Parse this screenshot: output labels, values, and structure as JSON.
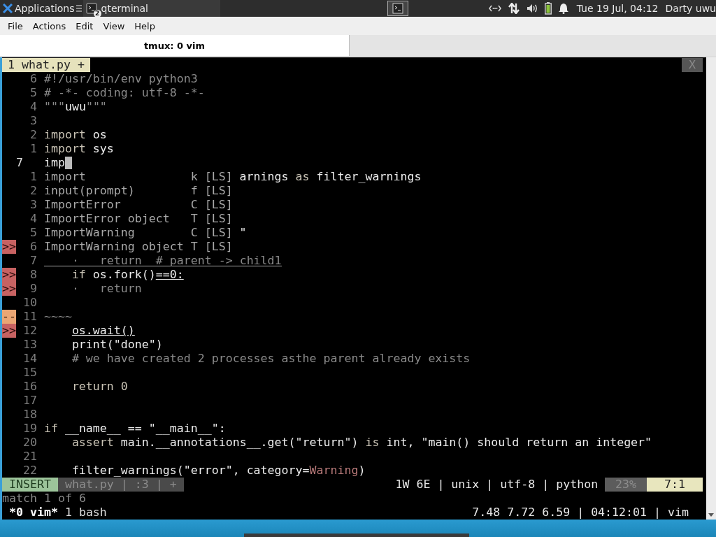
{
  "panel": {
    "apps_label": "Applications",
    "task": {
      "label": "qterminal",
      "badge": "2"
    },
    "clock": "Tue 19 Jul, 04:12",
    "user": "Darty uwu"
  },
  "menu": [
    "File",
    "Actions",
    "Edit",
    "View",
    "Help"
  ],
  "tabs": [
    {
      "label": "tmux: 0 vim",
      "selected": true
    }
  ],
  "vim": {
    "buffer_tab": {
      "label": "1 what.py +",
      "selected": true
    },
    "close_label": "X",
    "rows": [
      {
        "number": "6",
        "segments": [
          {
            "text": "#!/usr/bin/env python3",
            "kind": "comment"
          }
        ]
      },
      {
        "number": "5",
        "segments": [
          {
            "text": "# -*- coding: utf-8 -*-",
            "kind": "comment"
          }
        ]
      },
      {
        "number": "4",
        "segments": [
          {
            "text": "\"\"\"",
            "kind": "comment"
          },
          {
            "text": "uwu",
            "kind": "plain"
          },
          {
            "text": "\"\"\"",
            "kind": "comment"
          }
        ]
      },
      {
        "number": "3"
      },
      {
        "number": "2",
        "segments": [
          {
            "text": "import",
            "kind": "keyword"
          },
          {
            "text": " os",
            "kind": "plain"
          }
        ]
      },
      {
        "number": "1",
        "segments": [
          {
            "text": "import",
            "kind": "keyword"
          },
          {
            "text": " sys",
            "kind": "plain"
          }
        ]
      },
      {
        "number": "7",
        "current": true,
        "cursor": true,
        "segments": [
          {
            "text": "imp",
            "kind": "plain"
          }
        ]
      },
      {
        "number": "1",
        "completion": {
          "word": "import",
          "letter": "k",
          "source": "[LS]"
        },
        "segments": [
          {
            "text": "arnings",
            "kind": "plain"
          },
          {
            "text": " as ",
            "kind": "keyword"
          },
          {
            "text": "filter_warnings",
            "kind": "plain"
          }
        ]
      },
      {
        "number": "2",
        "completion": {
          "word": "input(prompt)",
          "letter": "f",
          "source": "[LS]"
        }
      },
      {
        "number": "3",
        "completion": {
          "word": "ImportError",
          "letter": "C",
          "source": "[LS]"
        }
      },
      {
        "number": "4",
        "completion": {
          "word": "ImportError object",
          "letter": "T",
          "source": "[LS]"
        }
      },
      {
        "number": "5",
        "completion": {
          "word": "ImportWarning",
          "letter": "C",
          "source": "[LS]"
        },
        "segments": [
          {
            "text": "\"",
            "kind": "plain"
          }
        ]
      },
      {
        "number": "6",
        "sign": {
          "text": ">>",
          "kind": "error"
        },
        "completion": {
          "word": "ImportWarning object",
          "letter": "T",
          "source": "[LS]"
        }
      },
      {
        "number": "7",
        "underlined": true,
        "indented": true,
        "segments": [
          {
            "text": "·   return  # parent -> child1",
            "kind": "comment"
          }
        ]
      },
      {
        "number": "8",
        "sign": {
          "text": ">>",
          "kind": "error"
        },
        "indented": true,
        "segments": [
          {
            "text": "if",
            "kind": "keyword"
          },
          {
            "text": " os.fork()",
            "kind": "plain"
          },
          {
            "text": "==0:",
            "kind": "underline"
          }
        ]
      },
      {
        "number": "9",
        "sign": {
          "text": ">>",
          "kind": "error"
        },
        "indented": true,
        "segments": [
          {
            "text": "·   return",
            "kind": "comment"
          }
        ]
      },
      {
        "number": "10"
      },
      {
        "number": "11",
        "sign": {
          "text": "--",
          "kind": "warning"
        },
        "segments": [
          {
            "text": "~~~~",
            "kind": "comment"
          }
        ]
      },
      {
        "number": "12",
        "sign": {
          "text": ">>",
          "kind": "error"
        },
        "indented": true,
        "segments": [
          {
            "text": "os.wait()",
            "kind": "underline"
          }
        ]
      },
      {
        "number": "13",
        "indented": true,
        "segments": [
          {
            "text": "print(\"done\")",
            "kind": "plain"
          }
        ]
      },
      {
        "number": "14",
        "indented": true,
        "segments": [
          {
            "text": "# we have created 2 processes asthe parent already exists",
            "kind": "comment"
          }
        ]
      },
      {
        "number": "15"
      },
      {
        "number": "16",
        "indented": true,
        "segments": [
          {
            "text": "return 0",
            "kind": "keyword"
          }
        ]
      },
      {
        "number": "17"
      },
      {
        "number": "18"
      },
      {
        "number": "19",
        "segments": [
          {
            "text": "if",
            "kind": "keyword"
          },
          {
            "text": " __name__ == \"__main__\":",
            "kind": "plain"
          }
        ]
      },
      {
        "number": "20",
        "indented": true,
        "segments": [
          {
            "text": "assert",
            "kind": "keyword"
          },
          {
            "text": " main.__annotations__.get(\"return\") ",
            "kind": "plain"
          },
          {
            "text": "is",
            "kind": "keyword"
          },
          {
            "text": " int, \"main() should return an integer\"",
            "kind": "plain"
          }
        ]
      },
      {
        "number": "21"
      },
      {
        "number": "22",
        "indented": true,
        "segments": [
          {
            "text": "filter_warnings(\"error\", category=",
            "kind": "plain"
          },
          {
            "text": "Warning",
            "kind": "type"
          },
          {
            "text": ")",
            "kind": "plain"
          }
        ]
      }
    ],
    "statusline": {
      "mode": "INSERT",
      "file_info": "what.py | :3 | +",
      "info": "1W 6E | unix | utf-8 | python",
      "percent": "23%",
      "position": "7:1"
    },
    "message": "match 1 of 6"
  },
  "tmux": {
    "windows": [
      {
        "label": "*0 vim*",
        "selected": true
      },
      {
        "label": "1 bash",
        "selected": false
      }
    ],
    "status": "7.48 7.72 6.59 | 04:12:01 | vim"
  }
}
